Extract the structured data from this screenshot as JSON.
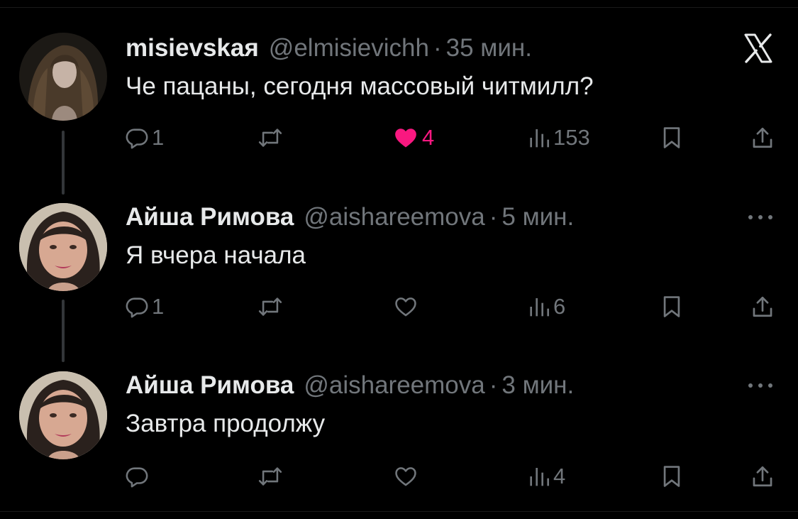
{
  "brand_icon": "x-logo-icon",
  "colors": {
    "background": "#000000",
    "text": "#e7e9ea",
    "muted": "#71767b",
    "like": "#f91880",
    "thread": "#333639"
  },
  "tweets": [
    {
      "name": "misievskaя",
      "handle": "@elmisievichh",
      "separator": "·",
      "time": "35 мин.",
      "text": "Че пацаны, сегодня массовый читмилл?",
      "replies": "1",
      "retweets": "",
      "likes": "4",
      "liked": true,
      "views": "153"
    },
    {
      "name": "Айша Римова",
      "handle": "@aishareemova",
      "separator": "·",
      "time": "5 мин.",
      "text": "Я вчера начала",
      "replies": "1",
      "retweets": "",
      "likes": "",
      "liked": false,
      "views": "6"
    },
    {
      "name": "Айша Римова",
      "handle": "@aishareemova",
      "separator": "·",
      "time": "3 мин.",
      "text": "Завтра продолжу",
      "replies": "",
      "retweets": "",
      "likes": "",
      "liked": false,
      "views": "4"
    }
  ]
}
